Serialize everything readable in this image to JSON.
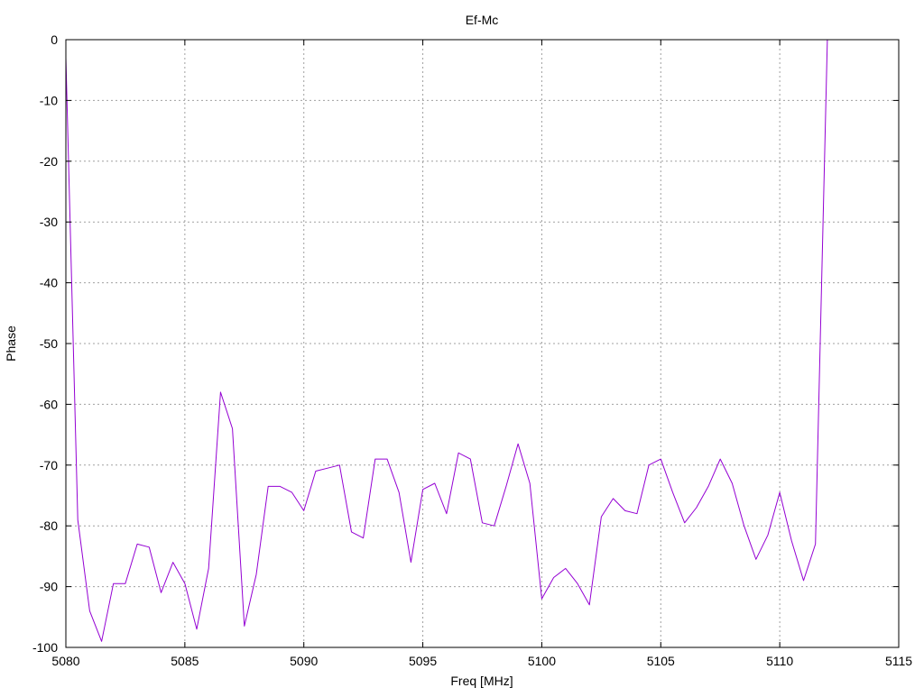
{
  "chart_data": {
    "type": "line",
    "title": "Ef-Mc",
    "xlabel": "Freq [MHz]",
    "ylabel": "Phase",
    "xlim": [
      5080,
      5115
    ],
    "ylim": [
      -100,
      0
    ],
    "xticks": [
      5080,
      5085,
      5090,
      5095,
      5100,
      5105,
      5110,
      5115
    ],
    "yticks": [
      0,
      -10,
      -20,
      -30,
      -40,
      -50,
      -60,
      -70,
      -80,
      -90,
      -100
    ],
    "grid": true,
    "series": [
      {
        "color": "#9400d3",
        "x": [
          5080.0,
          5080.5,
          5081.0,
          5081.5,
          5082.0,
          5082.5,
          5083.0,
          5083.5,
          5084.0,
          5084.5,
          5085.0,
          5085.5,
          5086.0,
          5086.5,
          5087.0,
          5087.5,
          5088.0,
          5088.5,
          5089.0,
          5089.5,
          5090.0,
          5090.5,
          5091.0,
          5091.5,
          5092.0,
          5092.5,
          5093.0,
          5093.5,
          5094.0,
          5094.5,
          5095.0,
          5095.5,
          5096.0,
          5096.5,
          5097.0,
          5097.5,
          5098.0,
          5098.5,
          5099.0,
          5099.5,
          5100.0,
          5100.5,
          5101.0,
          5101.5,
          5102.0,
          5102.5,
          5103.0,
          5103.5,
          5104.0,
          5104.5,
          5105.0,
          5105.5,
          5106.0,
          5106.5,
          5107.0,
          5107.5,
          5108.0,
          5108.5,
          5109.0,
          5109.5,
          5110.0,
          5110.5,
          5111.0,
          5111.5,
          5112.0
        ],
        "y": [
          -3,
          -79,
          -94,
          -99,
          -89.5,
          -89.5,
          -83,
          -83.5,
          -91,
          -86,
          -89.5,
          -97,
          -87,
          -58,
          -64,
          -96.5,
          -88,
          -73.5,
          -73.5,
          -74.5,
          -77.5,
          -71,
          -70.5,
          -70,
          -81,
          -82,
          -69,
          -69,
          -74.5,
          -86,
          -74,
          -73,
          -78,
          -68,
          -69,
          -79.5,
          -80,
          -73.5,
          -66.5,
          -73,
          -92,
          -88.5,
          -87,
          -89.5,
          -93,
          -78.5,
          -75.5,
          -77.5,
          -78,
          -70,
          -69,
          -74.5,
          -79.5,
          -77,
          -73.5,
          -69,
          -73,
          -80,
          -85.5,
          -81.5,
          -74.5,
          -82.5,
          -89,
          -83,
          0
        ]
      }
    ]
  }
}
